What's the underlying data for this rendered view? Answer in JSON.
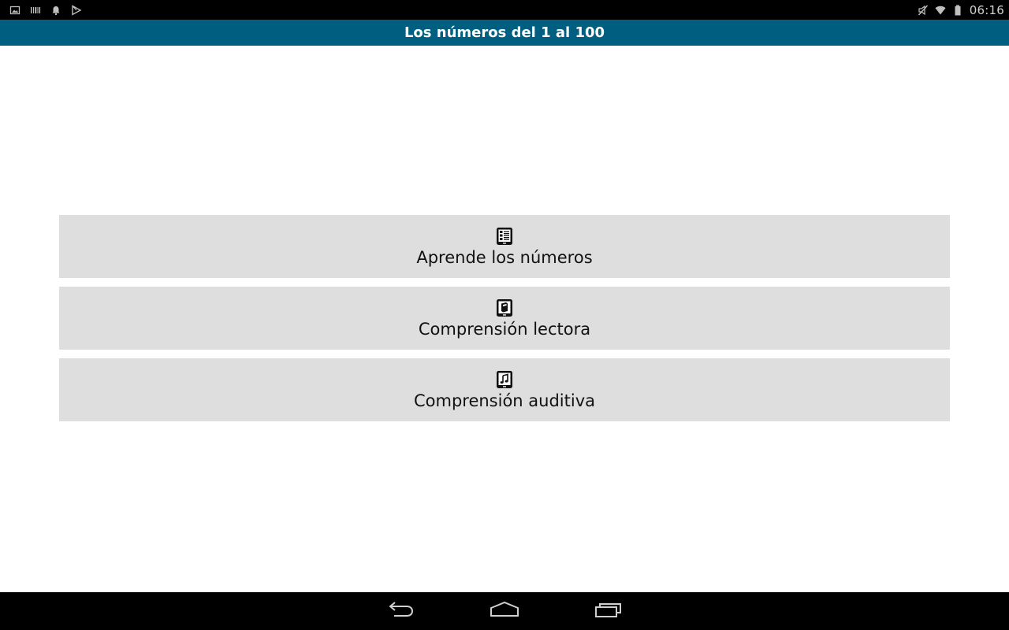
{
  "status_bar": {
    "left_icons": [
      "gallery-icon",
      "barcode-icon",
      "notification-bell-icon",
      "play-store-icon"
    ],
    "right_icons": [
      "mute-icon",
      "wifi-icon",
      "battery-icon"
    ],
    "time": "06:16"
  },
  "header": {
    "title": "Los números del 1 al 100"
  },
  "menu": {
    "items": [
      {
        "icon": "reading-tablet-icon",
        "label": "Aprende los números"
      },
      {
        "icon": "tablet-book-icon",
        "label": "Comprensión lectora"
      },
      {
        "icon": "tablet-music-icon",
        "label": "Comprensión auditiva"
      }
    ]
  },
  "nav_bar": {
    "buttons": [
      "back-icon",
      "home-icon",
      "recent-apps-icon"
    ]
  },
  "colors": {
    "title_bar": "#005f80",
    "button_bg": "#dedede",
    "system_bars": "#000000"
  }
}
